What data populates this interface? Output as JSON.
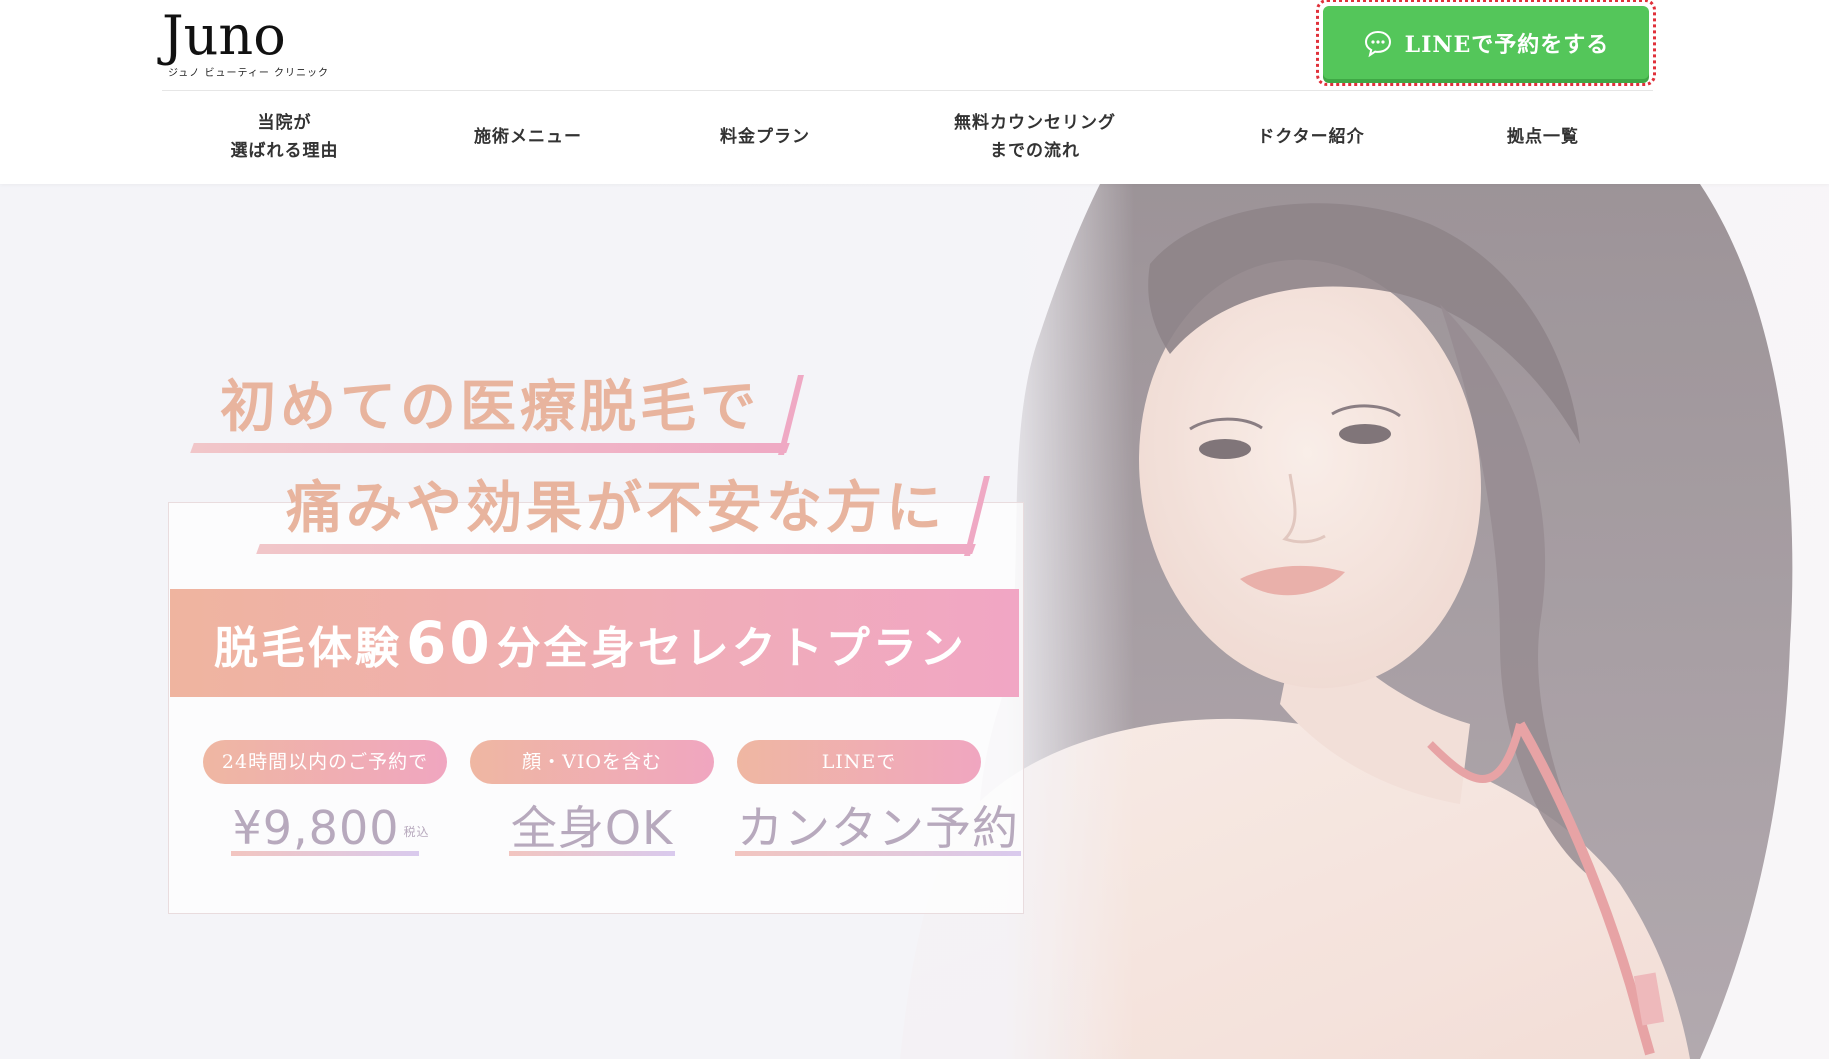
{
  "header": {
    "logo_text": "Juno",
    "logo_sub": "ジュノ ビューティー クリニック",
    "line_button_label": "LINEで予約をする",
    "nav": [
      {
        "line1": "当院が",
        "line2": "選ばれる理由"
      },
      {
        "line1": "施術メニュー",
        "line2": ""
      },
      {
        "line1": "料金プラン",
        "line2": ""
      },
      {
        "line1": "無料カウンセリング",
        "line2": "までの流れ"
      },
      {
        "line1": "ドクター紹介",
        "line2": ""
      },
      {
        "line1": "拠点一覧",
        "line2": ""
      }
    ]
  },
  "hero": {
    "catch_line_1": "初めての医療脱毛で",
    "catch_line_2": "痛みや効果が不安な方に",
    "plan": {
      "prefix": "脱毛体験",
      "number": "60",
      "suffix": "分全身セレクトプラン"
    },
    "features": [
      {
        "pill": "24時間以内のご予約で",
        "value": "¥9,800",
        "note": "税込"
      },
      {
        "pill": "顔・VIOを含む",
        "value": "全身OK",
        "note": ""
      },
      {
        "pill": "LINEで",
        "value": "カンタン予約",
        "note": ""
      }
    ]
  },
  "colors": {
    "line_green": "#54c65a",
    "accent_pink": "#f0a6c0",
    "accent_peach": "#efb49f",
    "focus_outline": "#e0303a"
  },
  "icons": {
    "line_button_icon": "chat-bubble-icon"
  }
}
